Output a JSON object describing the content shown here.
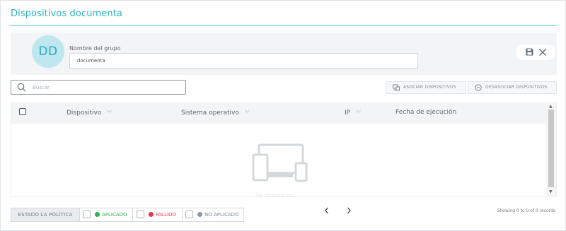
{
  "window": {
    "title": "Dispositivos documenta"
  },
  "group": {
    "avatar_initials": "DD",
    "name_label": "Nombre del grupo",
    "name_value": "documenta"
  },
  "icons": {
    "save": "floppy-disk",
    "close": "x-mark",
    "search": "magnifier",
    "associate": "monitor-link",
    "disassociate": "circle-minus",
    "sort": "chevron-down",
    "prev": "chevron-left",
    "next": "chevron-right",
    "empty": "devices"
  },
  "search": {
    "placeholder": "Buscar",
    "value": ""
  },
  "toolbar": {
    "associate_label": "ASOCIAR DISPOSITIVOS",
    "disassociate_label": "DESASOCIAR DISPOSITIVOS"
  },
  "table": {
    "columns": [
      {
        "label": "Dispositivo",
        "sortable": true
      },
      {
        "label": "Sistema operativo",
        "sortable": true
      },
      {
        "label": "IP",
        "sortable": true
      },
      {
        "label": "Fecha de ejecución",
        "sortable": false
      }
    ],
    "rows": [],
    "empty_text": "Sin dispositivos"
  },
  "legend": {
    "title": "ESTADO LA POLÍTICA",
    "items": [
      {
        "label": "APLICADO",
        "color": "#2eb44a"
      },
      {
        "label": "FALLIDO",
        "color": "#e5354c"
      },
      {
        "label": "NO APLICADO",
        "color": "#8a96a8"
      }
    ]
  },
  "pagination": {
    "records_text": "Showing 0 to 0 of 0 records"
  },
  "colors": {
    "accent": "#2bb3c0",
    "avatar_bg": "#bfe7ef"
  }
}
